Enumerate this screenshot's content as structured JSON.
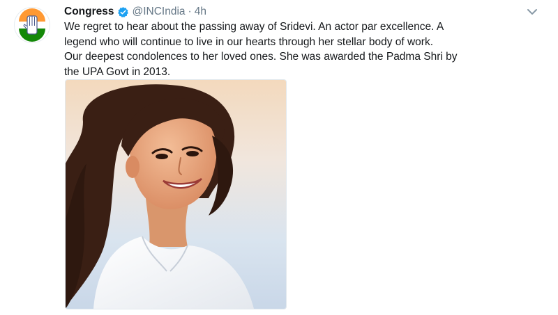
{
  "tweet": {
    "display_name": "Congress",
    "handle": "@INCIndia",
    "separator": "·",
    "timestamp": "4h",
    "text": "We regret to hear about the passing away of Sridevi. An actor par excellence. A\nlegend who will continue to live in our hearts through her stellar body of work.\nOur deepest condolences to her loved ones. She was awarded the Padma Shri by\nthe UPA Govt in 2013.",
    "avatar_icon": "congress-hand-logo-icon",
    "verified_icon": "verified-badge-icon",
    "menu_icon": "chevron-down-icon",
    "media": {
      "subject": "photo-of-smiling-woman-icon"
    }
  },
  "colors": {
    "text_primary": "#14171a",
    "text_secondary": "#657786",
    "verified_blue": "#1da1f2",
    "flag_saffron": "#ff9933",
    "flag_green": "#138808"
  }
}
